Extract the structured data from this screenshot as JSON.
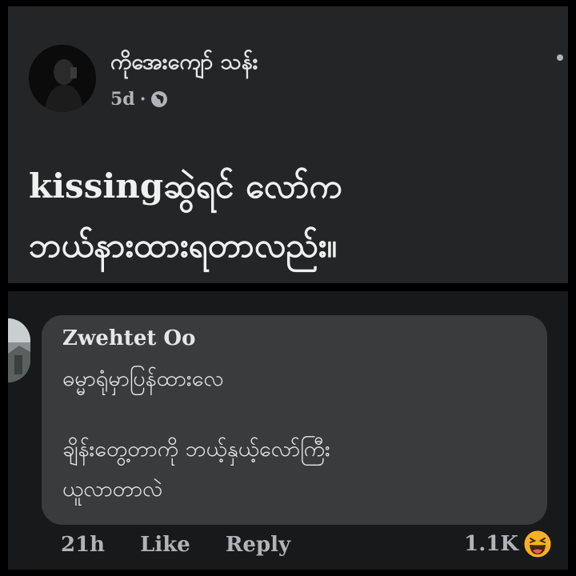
{
  "post": {
    "author": "ကိုအေးကျော် သန်း",
    "time": "5d",
    "separator": "·",
    "privacy_icon": "globe-icon",
    "more_icon": "more-dot-icon",
    "text_line1": "kissingဆွဲရင် လော်က",
    "text_line2": "ဘယ်နားထားရတာလည်း။"
  },
  "comment": {
    "author": "Zwehtet Oo",
    "line1": "ဓမ္မာရုံမှာပြန်ထားလေ",
    "line2": "ချိန်းတွေ့တာကို ဘယ့်နှယ့်လော်ကြီး",
    "line3": "ယူလာတာလဲ",
    "time": "21h",
    "like_label": "Like",
    "reply_label": "Reply",
    "reaction_count": "1.1K",
    "reaction_icon": "haha-emoji-icon"
  },
  "colors": {
    "background": "#000000",
    "post_panel": "#242526",
    "comment_bubble": "#3a3b3c",
    "primary_text": "#e4e6eb",
    "secondary_text": "#b0b3b8",
    "haha_yellow": "#f7b125"
  }
}
